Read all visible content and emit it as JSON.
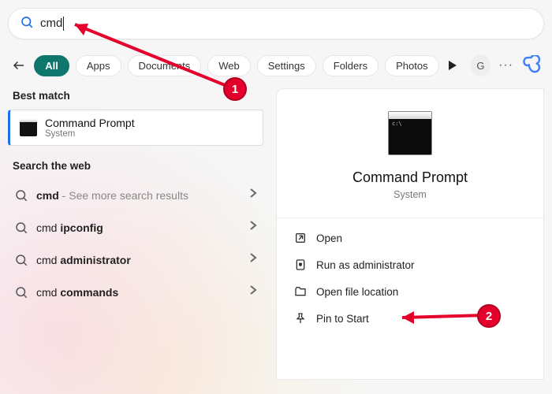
{
  "search": {
    "value": "cmd"
  },
  "filters": {
    "back": true,
    "tabs": [
      {
        "label": "All",
        "active": true
      },
      {
        "label": "Apps"
      },
      {
        "label": "Documents"
      },
      {
        "label": "Web"
      },
      {
        "label": "Settings"
      },
      {
        "label": "Folders"
      },
      {
        "label": "Photos"
      }
    ],
    "account_initial": "G"
  },
  "best_match": {
    "header": "Best match",
    "title": "Command Prompt",
    "subtitle": "System"
  },
  "search_web": {
    "header": "Search the web",
    "items": [
      {
        "bold": "cmd",
        "rest": "",
        "hint": " - See more search results"
      },
      {
        "bold": "cmd ",
        "rest": "ipconfig"
      },
      {
        "bold": "cmd ",
        "rest": "administrator"
      },
      {
        "bold": "cmd ",
        "rest": "commands"
      }
    ]
  },
  "preview": {
    "title": "Command Prompt",
    "subtitle": "System",
    "actions": [
      {
        "icon": "open",
        "label": "Open"
      },
      {
        "icon": "admin",
        "label": "Run as administrator"
      },
      {
        "icon": "folder",
        "label": "Open file location"
      },
      {
        "icon": "pin",
        "label": "Pin to Start"
      }
    ]
  },
  "annotations": {
    "m1": "1",
    "m2": "2"
  }
}
